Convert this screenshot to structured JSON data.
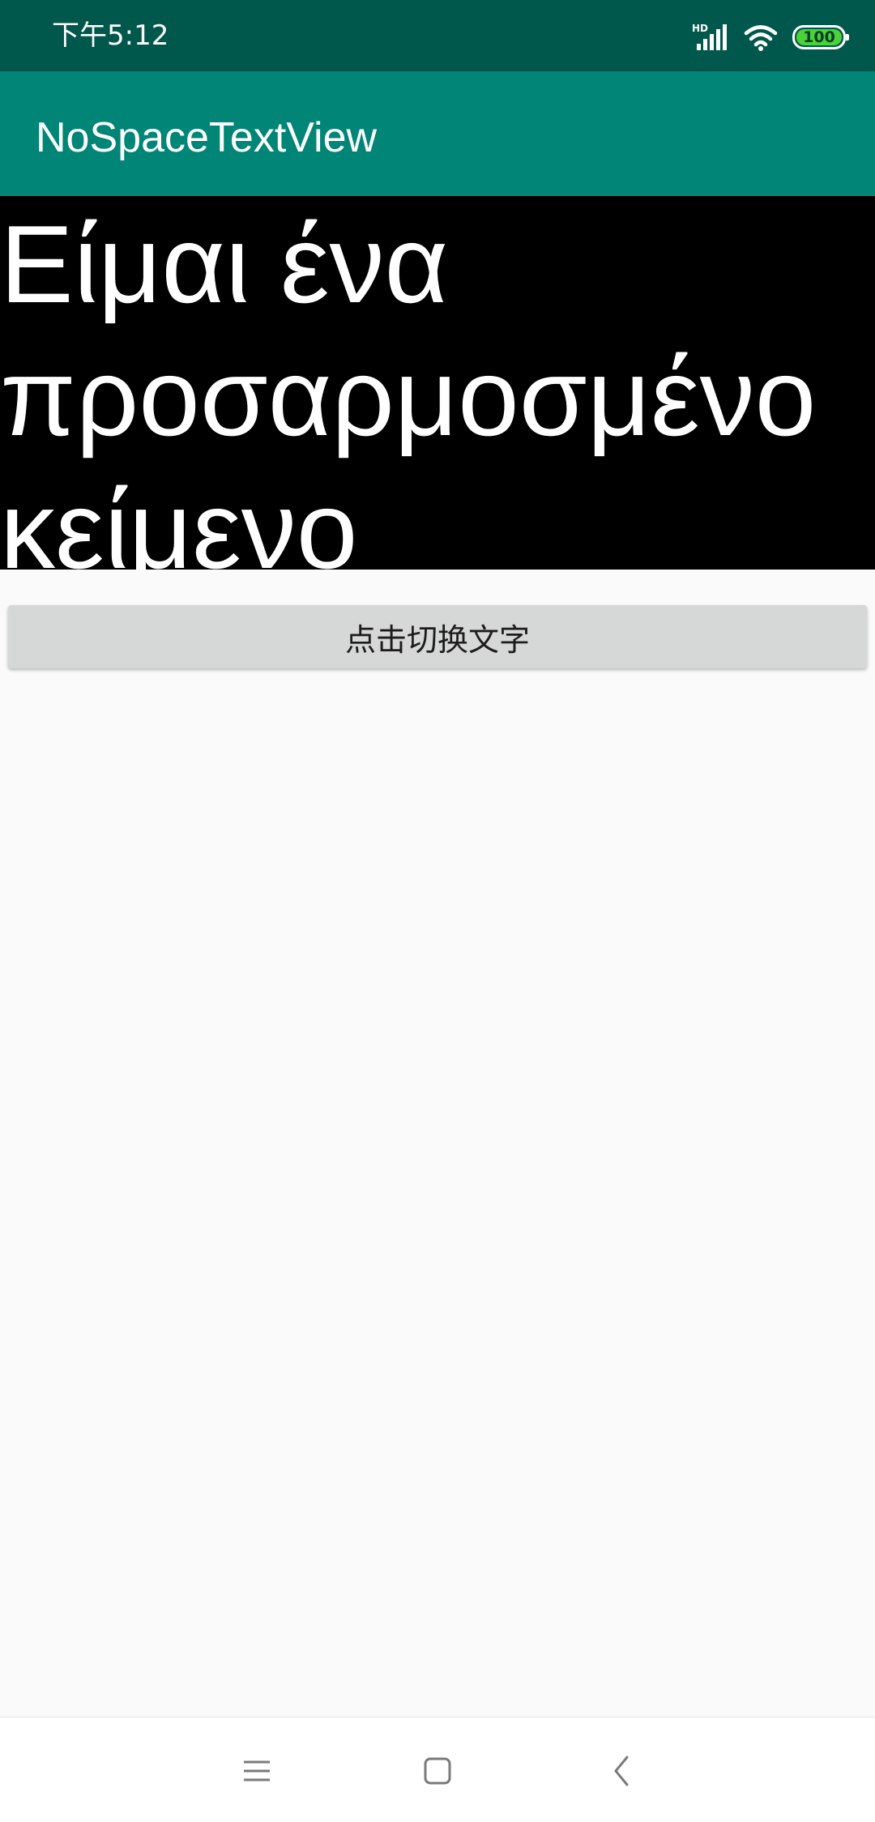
{
  "status_bar": {
    "time": "下午5:12",
    "network_label": "HD",
    "battery_level": "100",
    "icons": [
      "signal-icon",
      "wifi-icon",
      "battery-icon"
    ],
    "colors": {
      "background": "#00574b",
      "battery_fill": "#4cd137"
    }
  },
  "app_bar": {
    "title": "NoSpaceTextView",
    "color": "#008577"
  },
  "text_view": {
    "text": "Είμαι ένα\nπροσαρμοσμένο\nκείμενο",
    "background": "#000000",
    "text_color": "#ffffff"
  },
  "button": {
    "label": "点击切换文字"
  },
  "nav_bar": {
    "icons": [
      "menu-icon",
      "home-icon",
      "back-icon"
    ]
  }
}
